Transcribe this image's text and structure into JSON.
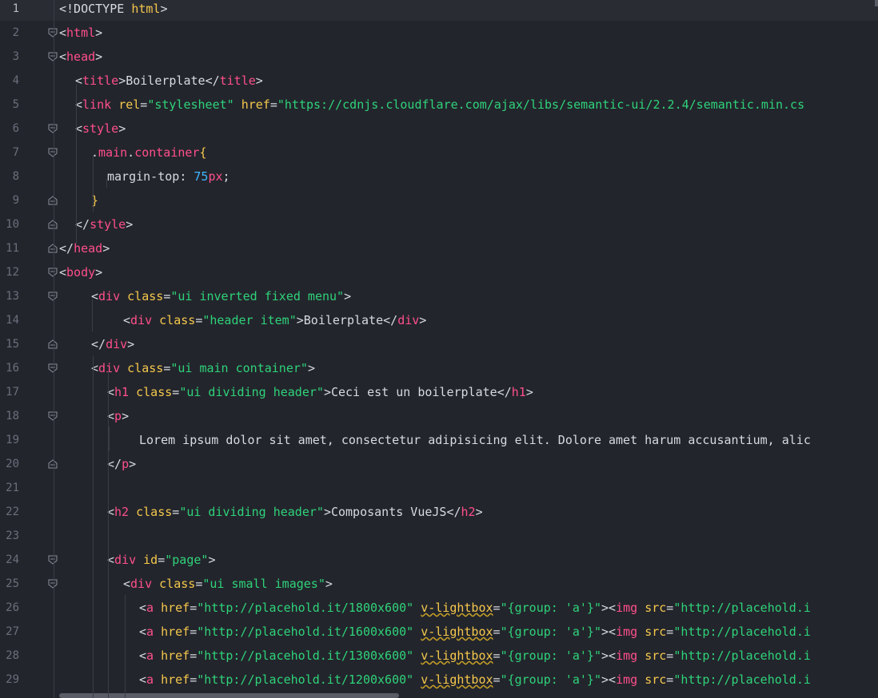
{
  "editor": {
    "lines": [
      {
        "n": "1",
        "tokens": [
          [
            "t-punc",
            "<!DOCTYPE "
          ],
          [
            "t-attr",
            "html"
          ],
          [
            "t-punc",
            ">"
          ]
        ]
      },
      {
        "n": "2",
        "tokens": [
          [
            "t-punc",
            "<"
          ],
          [
            "t-tag",
            "html"
          ],
          [
            "t-punc",
            ">"
          ]
        ]
      },
      {
        "n": "3",
        "tokens": [
          [
            "t-punc",
            "<"
          ],
          [
            "t-tag",
            "head"
          ],
          [
            "t-punc",
            ">"
          ]
        ]
      },
      {
        "n": "4",
        "tokens": [
          [
            "t-punc",
            "<"
          ],
          [
            "t-tag",
            "title"
          ],
          [
            "t-punc",
            ">"
          ],
          [
            "t-text",
            "Boilerplate"
          ],
          [
            "t-punc",
            "</"
          ],
          [
            "t-tag",
            "title"
          ],
          [
            "t-punc",
            ">"
          ]
        ]
      },
      {
        "n": "5",
        "tokens": [
          [
            "t-punc",
            "<"
          ],
          [
            "t-tag",
            "link"
          ],
          [
            "t-text",
            " "
          ],
          [
            "t-attr",
            "rel"
          ],
          [
            "t-punc",
            "="
          ],
          [
            "t-str",
            "\"stylesheet\""
          ],
          [
            "t-text",
            " "
          ],
          [
            "t-attr",
            "href"
          ],
          [
            "t-punc",
            "="
          ],
          [
            "t-str",
            "\"https://cdnjs.cloudflare.com/ajax/libs/semantic-ui/2.2.4/semantic.min.cs"
          ]
        ]
      },
      {
        "n": "6",
        "tokens": [
          [
            "t-punc",
            "<"
          ],
          [
            "t-tag",
            "style"
          ],
          [
            "t-punc",
            ">"
          ]
        ]
      },
      {
        "n": "7",
        "tokens": [
          [
            "t-selpunc",
            "."
          ],
          [
            "t-sel",
            "main"
          ],
          [
            "t-selpunc",
            "."
          ],
          [
            "t-sel",
            "container"
          ],
          [
            "t-brace",
            "{"
          ]
        ]
      },
      {
        "n": "8",
        "tokens": [
          [
            "t-prop",
            "margin-top"
          ],
          [
            "t-punc",
            ": "
          ],
          [
            "t-numv",
            "75"
          ],
          [
            "t-unit",
            "px"
          ],
          [
            "t-punc",
            ";"
          ]
        ]
      },
      {
        "n": "9",
        "tokens": [
          [
            "t-brace",
            "}"
          ]
        ]
      },
      {
        "n": "10",
        "tokens": [
          [
            "t-punc",
            "</"
          ],
          [
            "t-tag",
            "style"
          ],
          [
            "t-punc",
            ">"
          ]
        ]
      },
      {
        "n": "11",
        "tokens": [
          [
            "t-punc",
            "</"
          ],
          [
            "t-tag",
            "head"
          ],
          [
            "t-punc",
            ">"
          ]
        ]
      },
      {
        "n": "12",
        "tokens": [
          [
            "t-punc",
            "<"
          ],
          [
            "t-tag",
            "body"
          ],
          [
            "t-punc",
            ">"
          ]
        ]
      },
      {
        "n": "13",
        "tokens": [
          [
            "t-punc",
            "<"
          ],
          [
            "t-tag",
            "div"
          ],
          [
            "t-text",
            " "
          ],
          [
            "t-attr",
            "class"
          ],
          [
            "t-punc",
            "="
          ],
          [
            "t-str",
            "\"ui inverted fixed menu\""
          ],
          [
            "t-punc",
            ">"
          ]
        ]
      },
      {
        "n": "14",
        "tokens": [
          [
            "t-punc",
            "<"
          ],
          [
            "t-tag",
            "div"
          ],
          [
            "t-text",
            " "
          ],
          [
            "t-attr",
            "class"
          ],
          [
            "t-punc",
            "="
          ],
          [
            "t-str",
            "\"header item\""
          ],
          [
            "t-punc",
            ">"
          ],
          [
            "t-text",
            "Boilerplate"
          ],
          [
            "t-punc",
            "</"
          ],
          [
            "t-tag",
            "div"
          ],
          [
            "t-punc",
            ">"
          ]
        ]
      },
      {
        "n": "15",
        "tokens": [
          [
            "t-punc",
            "</"
          ],
          [
            "t-tag",
            "div"
          ],
          [
            "t-punc",
            ">"
          ]
        ]
      },
      {
        "n": "16",
        "tokens": [
          [
            "t-punc",
            "<"
          ],
          [
            "t-tag",
            "div"
          ],
          [
            "t-text",
            " "
          ],
          [
            "t-attr",
            "class"
          ],
          [
            "t-punc",
            "="
          ],
          [
            "t-str",
            "\"ui main container\""
          ],
          [
            "t-punc",
            ">"
          ]
        ]
      },
      {
        "n": "17",
        "tokens": [
          [
            "t-punc",
            "<"
          ],
          [
            "t-tag",
            "h1"
          ],
          [
            "t-text",
            " "
          ],
          [
            "t-attr",
            "class"
          ],
          [
            "t-punc",
            "="
          ],
          [
            "t-str",
            "\"ui dividing header\""
          ],
          [
            "t-punc",
            ">"
          ],
          [
            "t-text",
            "Ceci est un boilerplate"
          ],
          [
            "t-punc",
            "</"
          ],
          [
            "t-tag",
            "h1"
          ],
          [
            "t-punc",
            ">"
          ]
        ]
      },
      {
        "n": "18",
        "tokens": [
          [
            "t-punc",
            "<"
          ],
          [
            "t-tag",
            "p"
          ],
          [
            "t-punc",
            ">"
          ]
        ]
      },
      {
        "n": "19",
        "tokens": [
          [
            "t-text",
            "Lorem ipsum dolor sit amet, consectetur adipisicing elit. Dolore amet harum accusantium, alic"
          ]
        ]
      },
      {
        "n": "20",
        "tokens": [
          [
            "t-punc",
            "</"
          ],
          [
            "t-tag",
            "p"
          ],
          [
            "t-punc",
            ">"
          ]
        ]
      },
      {
        "n": "21",
        "tokens": []
      },
      {
        "n": "22",
        "tokens": [
          [
            "t-punc",
            "<"
          ],
          [
            "t-tag",
            "h2"
          ],
          [
            "t-text",
            " "
          ],
          [
            "t-attr",
            "class"
          ],
          [
            "t-punc",
            "="
          ],
          [
            "t-str",
            "\"ui dividing header\""
          ],
          [
            "t-punc",
            ">"
          ],
          [
            "t-text",
            "Composants VueJS"
          ],
          [
            "t-punc",
            "</"
          ],
          [
            "t-tag",
            "h2"
          ],
          [
            "t-punc",
            ">"
          ]
        ]
      },
      {
        "n": "23",
        "tokens": []
      },
      {
        "n": "24",
        "tokens": [
          [
            "t-punc",
            "<"
          ],
          [
            "t-tag",
            "div"
          ],
          [
            "t-text",
            " "
          ],
          [
            "t-attr",
            "id"
          ],
          [
            "t-punc",
            "="
          ],
          [
            "t-str",
            "\"page\""
          ],
          [
            "t-punc",
            ">"
          ]
        ]
      },
      {
        "n": "25",
        "tokens": [
          [
            "t-punc",
            "<"
          ],
          [
            "t-tag",
            "div"
          ],
          [
            "t-text",
            " "
          ],
          [
            "t-attr",
            "class"
          ],
          [
            "t-punc",
            "="
          ],
          [
            "t-str",
            "\"ui small images\""
          ],
          [
            "t-punc",
            ">"
          ]
        ]
      },
      {
        "n": "26",
        "tokens": [
          [
            "t-punc",
            "<"
          ],
          [
            "t-tag",
            "a"
          ],
          [
            "t-text",
            " "
          ],
          [
            "t-attr",
            "href"
          ],
          [
            "t-punc",
            "="
          ],
          [
            "t-str",
            "\"http://placehold.it/1800x600\""
          ],
          [
            "t-text",
            " "
          ],
          [
            "t-attr warn",
            "v-lightbox"
          ],
          [
            "t-punc",
            "="
          ],
          [
            "t-str",
            "\"{group: 'a'}\""
          ],
          [
            "t-punc",
            "><"
          ],
          [
            "t-tag",
            "img"
          ],
          [
            "t-text",
            " "
          ],
          [
            "t-attr",
            "src"
          ],
          [
            "t-punc",
            "="
          ],
          [
            "t-str",
            "\"http://placehold.i"
          ]
        ]
      },
      {
        "n": "27",
        "tokens": [
          [
            "t-punc",
            "<"
          ],
          [
            "t-tag",
            "a"
          ],
          [
            "t-text",
            " "
          ],
          [
            "t-attr",
            "href"
          ],
          [
            "t-punc",
            "="
          ],
          [
            "t-str",
            "\"http://placehold.it/1600x600\""
          ],
          [
            "t-text",
            " "
          ],
          [
            "t-attr warn",
            "v-lightbox"
          ],
          [
            "t-punc",
            "="
          ],
          [
            "t-str",
            "\"{group: 'a'}\""
          ],
          [
            "t-punc",
            "><"
          ],
          [
            "t-tag",
            "img"
          ],
          [
            "t-text",
            " "
          ],
          [
            "t-attr",
            "src"
          ],
          [
            "t-punc",
            "="
          ],
          [
            "t-str",
            "\"http://placehold.i"
          ]
        ]
      },
      {
        "n": "28",
        "tokens": [
          [
            "t-punc",
            "<"
          ],
          [
            "t-tag",
            "a"
          ],
          [
            "t-text",
            " "
          ],
          [
            "t-attr",
            "href"
          ],
          [
            "t-punc",
            "="
          ],
          [
            "t-str",
            "\"http://placehold.it/1300x600\""
          ],
          [
            "t-text",
            " "
          ],
          [
            "t-attr warn",
            "v-lightbox"
          ],
          [
            "t-punc",
            "="
          ],
          [
            "t-str",
            "\"{group: 'a'}\""
          ],
          [
            "t-punc",
            "><"
          ],
          [
            "t-tag",
            "img"
          ],
          [
            "t-text",
            " "
          ],
          [
            "t-attr",
            "src"
          ],
          [
            "t-punc",
            "="
          ],
          [
            "t-str",
            "\"http://placehold.i"
          ]
        ]
      },
      {
        "n": "29",
        "tokens": [
          [
            "t-punc",
            "<"
          ],
          [
            "t-tag",
            "a"
          ],
          [
            "t-text",
            " "
          ],
          [
            "t-attr",
            "href"
          ],
          [
            "t-punc",
            "="
          ],
          [
            "t-str",
            "\"http://placehold.it/1200x600\""
          ],
          [
            "t-text",
            " "
          ],
          [
            "t-attr warn",
            "v-lightbox"
          ],
          [
            "t-punc",
            "="
          ],
          [
            "t-str",
            "\"{group: 'a'}\""
          ],
          [
            "t-punc",
            "><"
          ],
          [
            "t-tag",
            "img"
          ],
          [
            "t-text",
            " "
          ],
          [
            "t-attr",
            "src"
          ],
          [
            "t-punc",
            "="
          ],
          [
            "t-str",
            "\"http://placehold.i"
          ]
        ]
      }
    ]
  },
  "colors": {
    "background": "#23252c",
    "tag": "#ff4f8b",
    "attribute": "#f5c84c",
    "string": "#2ed37a",
    "number": "#3fb6ff",
    "text": "#d7dae0"
  }
}
